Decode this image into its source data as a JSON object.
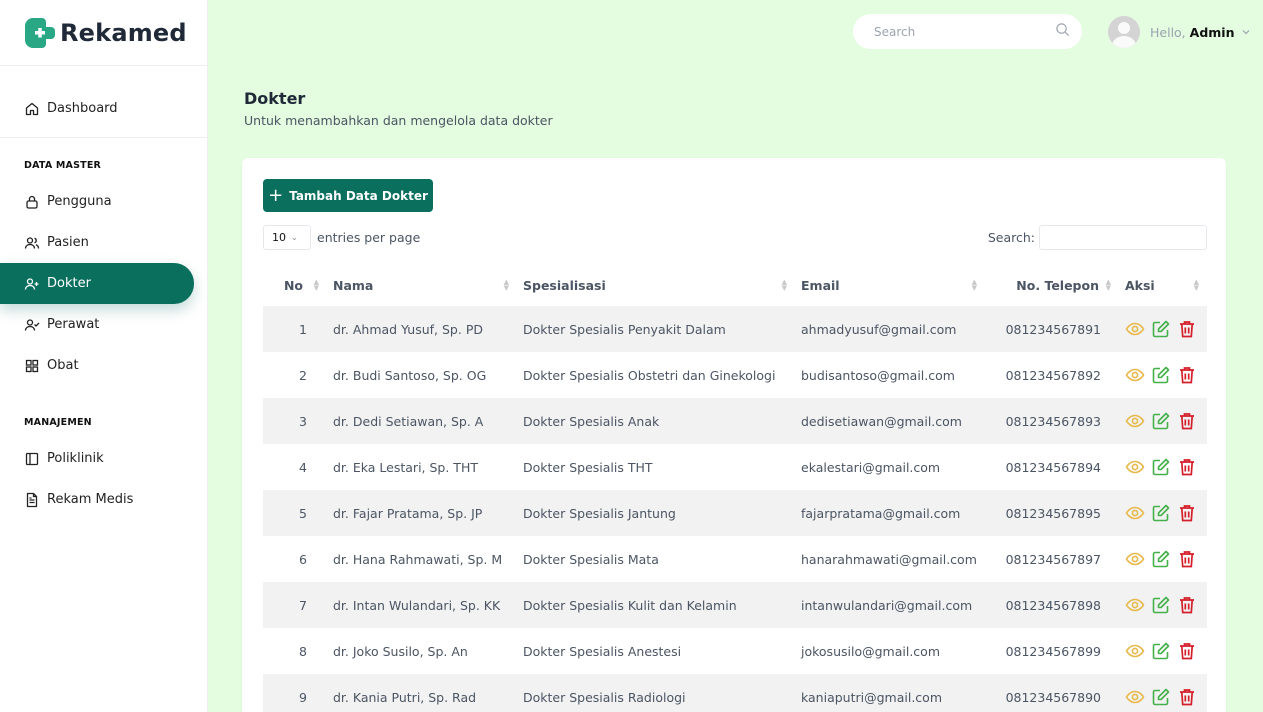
{
  "brand": {
    "name": "Rekamed"
  },
  "sidebar": {
    "dashboard": "Dashboard",
    "section_master": "DATA MASTER",
    "pengguna": "Pengguna",
    "pasien": "Pasien",
    "dokter": "Dokter",
    "perawat": "Perawat",
    "obat": "Obat",
    "section_manajemen": "MANAJEMEN",
    "poliklinik": "Poliklinik",
    "rekam_medis": "Rekam Medis"
  },
  "topbar": {
    "search_placeholder": "Search",
    "hello": "Hello,",
    "user": "Admin"
  },
  "page": {
    "title": "Dokter",
    "subtitle": "Untuk menambahkan dan mengelola data dokter"
  },
  "toolbar": {
    "add_label": "Tambah Data Dokter",
    "entries_value": "10",
    "entries_label": "entries per page",
    "search_label": "Search:"
  },
  "table": {
    "headers": {
      "no": "No",
      "nama": "Nama",
      "spesialisasi": "Spesialisasi",
      "email": "Email",
      "telepon": "No. Telepon",
      "aksi": "Aksi"
    },
    "rows": [
      {
        "no": "1",
        "nama": "dr. Ahmad Yusuf, Sp. PD",
        "spesialisasi": "Dokter Spesialis Penyakit Dalam",
        "email": "ahmadyusuf@gmail.com",
        "telepon": "081234567891"
      },
      {
        "no": "2",
        "nama": "dr. Budi Santoso, Sp. OG",
        "spesialisasi": "Dokter Spesialis Obstetri dan Ginekologi",
        "email": "budisantoso@gmail.com",
        "telepon": "081234567892"
      },
      {
        "no": "3",
        "nama": "dr. Dedi Setiawan, Sp. A",
        "spesialisasi": "Dokter Spesialis Anak",
        "email": "dedisetiawan@gmail.com",
        "telepon": "081234567893"
      },
      {
        "no": "4",
        "nama": "dr. Eka Lestari, Sp. THT",
        "spesialisasi": "Dokter Spesialis THT",
        "email": "ekalestari@gmail.com",
        "telepon": "081234567894"
      },
      {
        "no": "5",
        "nama": "dr. Fajar Pratama, Sp. JP",
        "spesialisasi": "Dokter Spesialis Jantung",
        "email": "fajarpratama@gmail.com",
        "telepon": "081234567895"
      },
      {
        "no": "6",
        "nama": "dr. Hana Rahmawati, Sp. M",
        "spesialisasi": "Dokter Spesialis Mata",
        "email": "hanarahmawati@gmail.com",
        "telepon": "081234567897"
      },
      {
        "no": "7",
        "nama": "dr. Intan Wulandari, Sp. KK",
        "spesialisasi": "Dokter Spesialis Kulit dan Kelamin",
        "email": "intanwulandari@gmail.com",
        "telepon": "081234567898"
      },
      {
        "no": "8",
        "nama": "dr. Joko Susilo, Sp. An",
        "spesialisasi": "Dokter Spesialis Anestesi",
        "email": "jokosusilo@gmail.com",
        "telepon": "081234567899"
      },
      {
        "no": "9",
        "nama": "dr. Kania Putri, Sp. Rad",
        "spesialisasi": "Dokter Spesialis Radiologi",
        "email": "kaniaputri@gmail.com",
        "telepon": "081234567890"
      }
    ]
  },
  "colors": {
    "primary": "#0b6f5e",
    "background": "#e4fce0",
    "view": "#e8b84a",
    "edit": "#43b049",
    "delete": "#d41f2a"
  },
  "icons": {
    "view": "eye-icon",
    "edit": "edit-icon",
    "delete": "trash-icon"
  }
}
